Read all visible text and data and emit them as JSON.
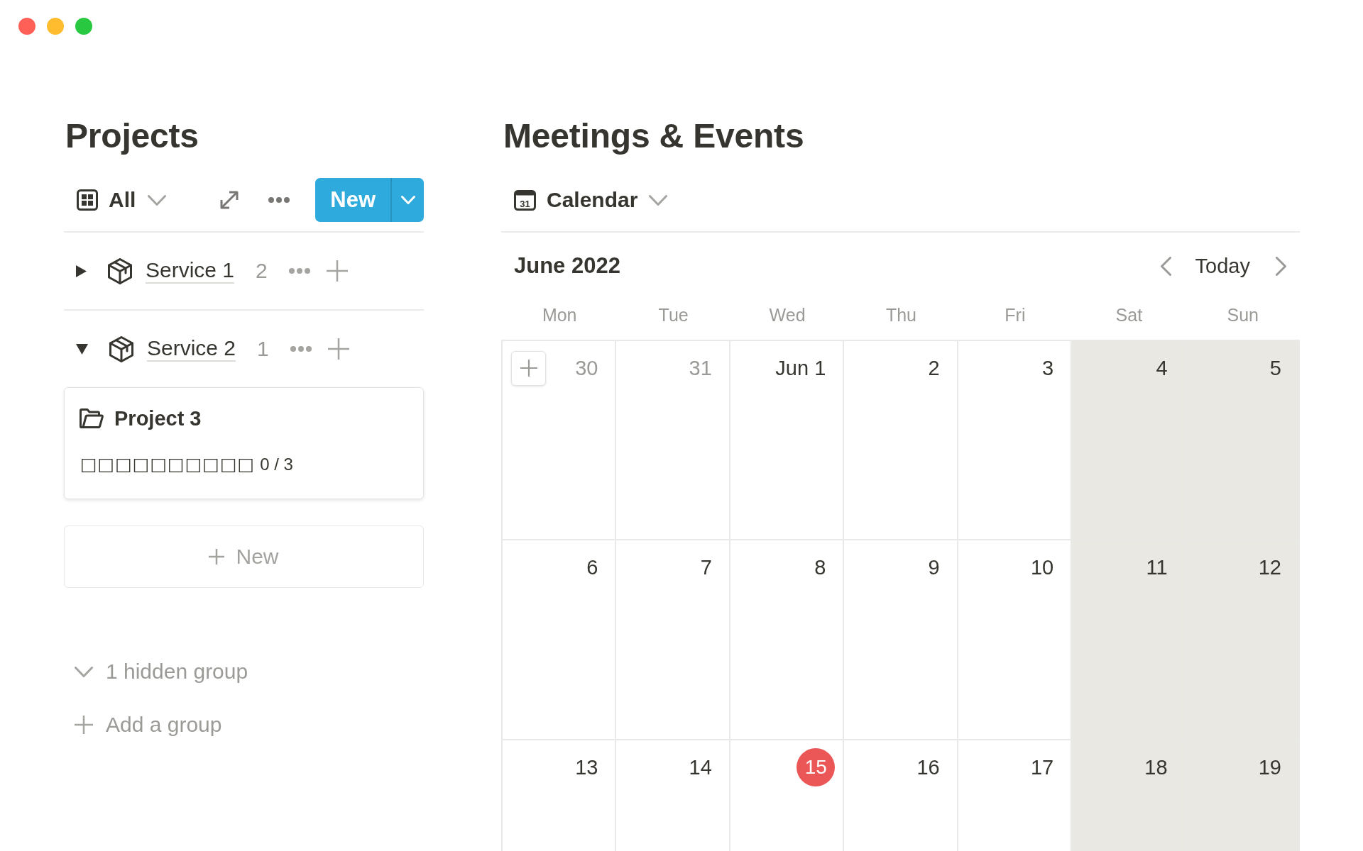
{
  "projects": {
    "title": "Projects",
    "view": {
      "label": "All"
    },
    "new_button": {
      "label": "New"
    },
    "groups": [
      {
        "name": "Service 1",
        "count": "2",
        "expanded": false
      },
      {
        "name": "Service 2",
        "count": "1",
        "expanded": true,
        "cards": [
          {
            "title": "Project 3",
            "progress_bar": "□□□□□□□□□□",
            "progress_text": "0 / 3"
          }
        ],
        "new_row": {
          "label": "New"
        }
      }
    ],
    "hidden_groups": {
      "label": "1 hidden group"
    },
    "add_group": {
      "label": "Add a group"
    }
  },
  "calendar": {
    "title": "Meetings & Events",
    "view": {
      "label": "Calendar",
      "icon_text": "31"
    },
    "month": "June 2022",
    "today_button": "Today",
    "weekdays": [
      {
        "label": "Mon",
        "weekend": false
      },
      {
        "label": "Tue",
        "weekend": false
      },
      {
        "label": "Wed",
        "weekend": false
      },
      {
        "label": "Thu",
        "weekend": false
      },
      {
        "label": "Fri",
        "weekend": false
      },
      {
        "label": "Sat",
        "weekend": true
      },
      {
        "label": "Sun",
        "weekend": true
      }
    ],
    "weeks": [
      {
        "days": [
          {
            "label": "30",
            "in_month": false,
            "today": false,
            "hovered": true
          },
          {
            "label": "31",
            "in_month": false,
            "today": false,
            "hovered": false
          },
          {
            "label": "Jun 1",
            "in_month": true,
            "today": false,
            "hovered": false
          },
          {
            "label": "2",
            "in_month": true,
            "today": false,
            "hovered": false
          },
          {
            "label": "3",
            "in_month": true,
            "today": false,
            "hovered": false
          },
          {
            "label": "4",
            "in_month": true,
            "today": false,
            "hovered": false
          },
          {
            "label": "5",
            "in_month": true,
            "today": false,
            "hovered": false
          }
        ]
      },
      {
        "days": [
          {
            "label": "6",
            "in_month": true,
            "today": false,
            "hovered": false
          },
          {
            "label": "7",
            "in_month": true,
            "today": false,
            "hovered": false
          },
          {
            "label": "8",
            "in_month": true,
            "today": false,
            "hovered": false
          },
          {
            "label": "9",
            "in_month": true,
            "today": false,
            "hovered": false
          },
          {
            "label": "10",
            "in_month": true,
            "today": false,
            "hovered": false
          },
          {
            "label": "11",
            "in_month": true,
            "today": false,
            "hovered": false
          },
          {
            "label": "12",
            "in_month": true,
            "today": false,
            "hovered": false
          }
        ]
      },
      {
        "days": [
          {
            "label": "13",
            "in_month": true,
            "today": false,
            "hovered": false
          },
          {
            "label": "14",
            "in_month": true,
            "today": false,
            "hovered": false
          },
          {
            "label": "15",
            "in_month": true,
            "today": true,
            "hovered": false
          },
          {
            "label": "16",
            "in_month": true,
            "today": false,
            "hovered": false
          },
          {
            "label": "17",
            "in_month": true,
            "today": false,
            "hovered": false
          },
          {
            "label": "18",
            "in_month": true,
            "today": false,
            "hovered": false
          },
          {
            "label": "19",
            "in_month": true,
            "today": false,
            "hovered": false
          }
        ]
      }
    ]
  }
}
